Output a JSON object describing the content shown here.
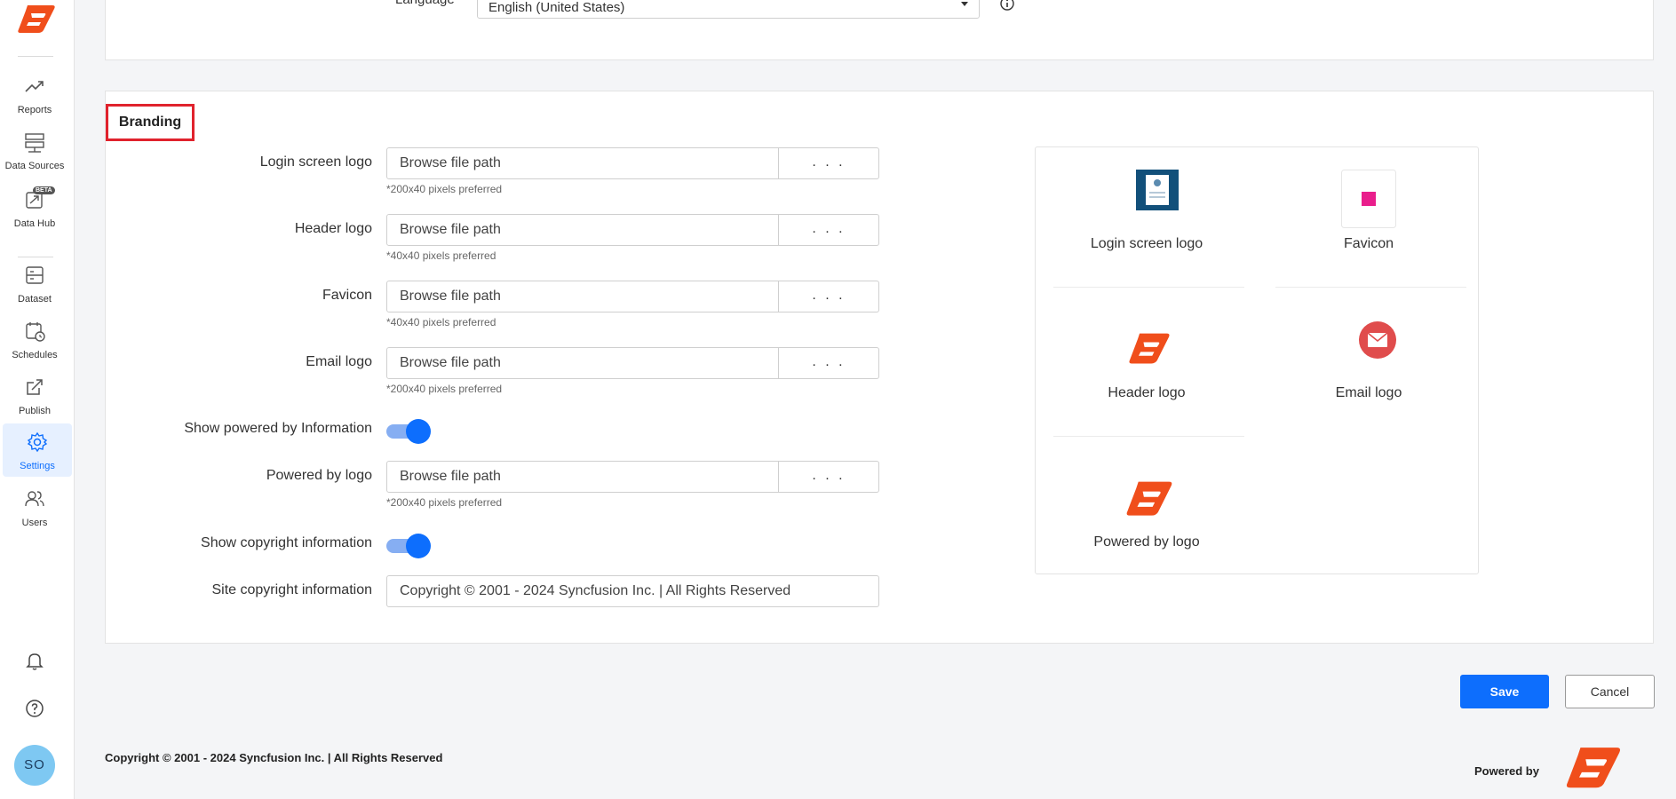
{
  "sidebar": {
    "items": [
      {
        "label": "Reports",
        "icon": "trend-up-icon"
      },
      {
        "label": "Data Sources",
        "icon": "server-icon"
      },
      {
        "label": "Data Hub",
        "icon": "data-hub-icon",
        "badge": "BETA"
      },
      {
        "label": "Dataset",
        "icon": "dataset-icon"
      },
      {
        "label": "Schedules",
        "icon": "calendar-clock-icon"
      },
      {
        "label": "Publish",
        "icon": "publish-icon"
      },
      {
        "label": "Settings",
        "icon": "gear-icon",
        "active": true
      },
      {
        "label": "Users",
        "icon": "users-icon"
      }
    ],
    "avatar_initials": "SO"
  },
  "language": {
    "label": "Language",
    "value": "English (United States)"
  },
  "branding": {
    "title": "Branding",
    "browse_label": ". . .",
    "rows": {
      "login_logo": {
        "label": "Login screen logo",
        "placeholder": "Browse file path",
        "hint": "*200x40 pixels preferred"
      },
      "header_logo": {
        "label": "Header logo",
        "placeholder": "Browse file path",
        "hint": "*40x40 pixels preferred"
      },
      "favicon": {
        "label": "Favicon",
        "placeholder": "Browse file path",
        "hint": "*40x40 pixels preferred"
      },
      "email_logo": {
        "label": "Email logo",
        "placeholder": "Browse file path",
        "hint": "*200x40 pixels preferred"
      },
      "show_powered": {
        "label": "Show powered by Information",
        "enabled": true
      },
      "powered_logo": {
        "label": "Powered by logo",
        "placeholder": "Browse file path",
        "hint": "*200x40 pixels preferred"
      },
      "show_copyright": {
        "label": "Show copyright information",
        "enabled": true
      },
      "site_copyright": {
        "label": "Site copyright information",
        "value": "Copyright © 2001 - 2024 Syncfusion Inc.   |   All Rights Reserved"
      }
    },
    "preview": {
      "login_logo": "Login screen logo",
      "favicon": "Favicon",
      "header_logo": "Header logo",
      "email_logo": "Email logo",
      "powered_logo": "Powered by logo"
    }
  },
  "actions": {
    "save": "Save",
    "cancel": "Cancel"
  },
  "footer": {
    "copyright": "Copyright © 2001 - 2024 Syncfusion Inc.   |   All Rights Reserved",
    "powered_by": "Powered by"
  },
  "colors": {
    "brand_orange": "#f04e1b",
    "accent_blue": "#0d6efd",
    "highlight_red": "#e0222d"
  }
}
